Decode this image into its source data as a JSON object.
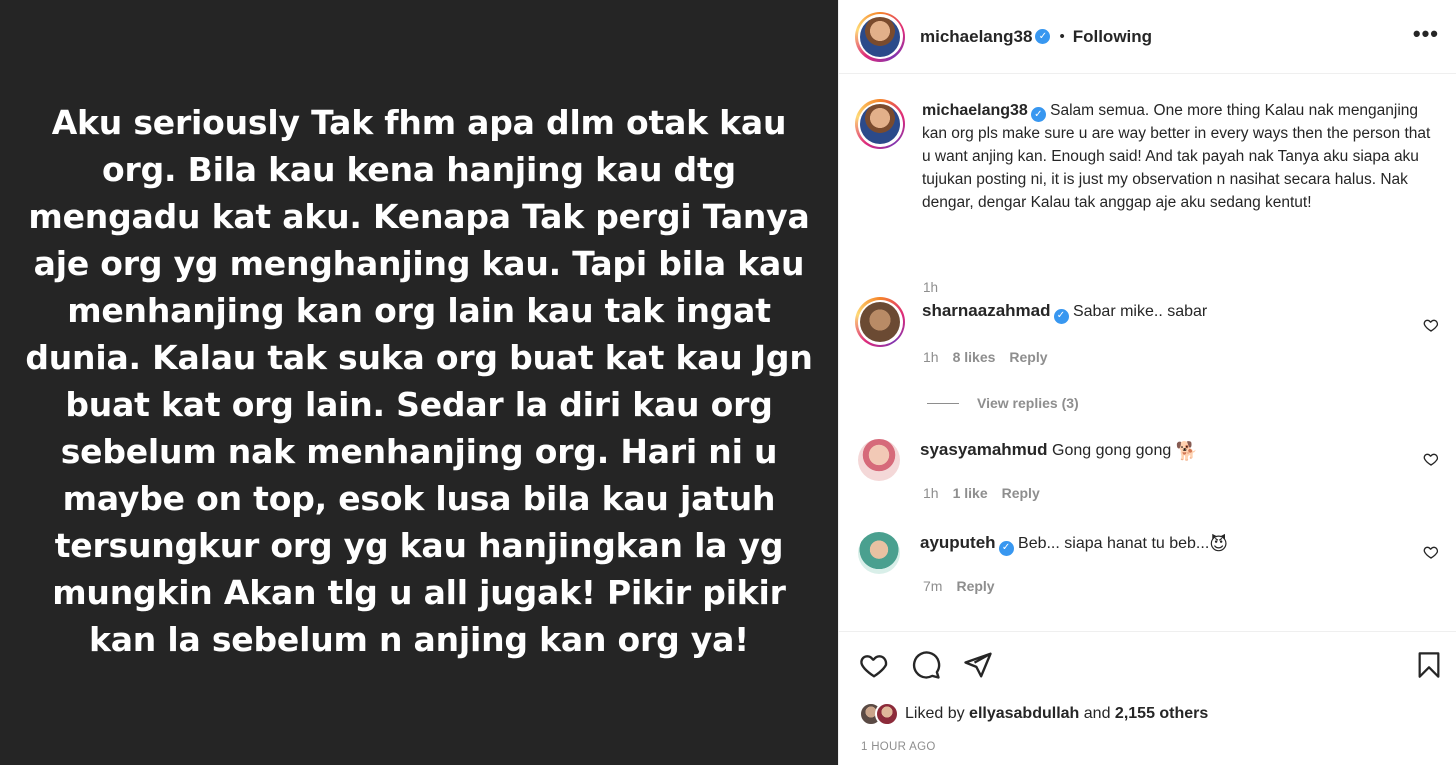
{
  "post": {
    "image_text": "Aku seriously Tak fhm apa dlm otak kau org. Bila kau kena hanjing kau dtg mengadu kat aku. Kenapa Tak pergi Tanya aje org yg menghanjing kau. Tapi bila kau menhanjing kan org lain kau tak ingat dunia. Kalau tak suka org buat kat kau Jgn buat kat org lain. Sedar la diri kau org sebelum nak menhanjing org. Hari ni u maybe on top, esok lusa bila kau jatuh tersungkur org yg kau hanjingkan la yg mungkin Akan tlg u all jugak! Pikir pikir kan la sebelum n anjing kan org ya!",
    "background_color": "#252525"
  },
  "header": {
    "username": "michaelang38",
    "verified_icon": "verified-badge-icon",
    "separator": "•",
    "follow_state": "Following",
    "more_label": "•••"
  },
  "caption": {
    "username": "michaelang38",
    "text": "Salam semua. One more thing Kalau nak menganjing kan org pls make sure u are way better in every ways then the person that u want anjing kan. Enough said! And tak payah nak Tanya aku siapa aku tujukan posting ni, it is just my observation n nasihat secara halus. Nak dengar, dengar Kalau tak anggap aje aku sedang kentut!",
    "time": "1h"
  },
  "comments": [
    {
      "username": "sharnaazahmad",
      "verified": true,
      "text": "Sabar mike.. sabar",
      "emoji": "",
      "time": "1h",
      "likes": "8 likes",
      "reply_label": "Reply"
    },
    {
      "username": "syasyamahmud",
      "verified": false,
      "text": "Gong gong gong ",
      "emoji": "🐕",
      "time": "1h",
      "likes": "1 like",
      "reply_label": "Reply"
    },
    {
      "username": "ayuputeh",
      "verified": true,
      "text": "Beb... siapa hanat tu beb...",
      "emoji": "😈",
      "time": "7m",
      "likes": "",
      "reply_label": "Reply"
    }
  ],
  "view_replies": "View replies (3)",
  "actions": {
    "icons": [
      "heart-icon",
      "comment-icon",
      "share-icon",
      "bookmark-icon"
    ]
  },
  "likes": {
    "prefix": "Liked by",
    "user": "ellyasabdullah",
    "joiner": "and",
    "others": "2,155 others"
  },
  "timestamp": "1 HOUR AGO",
  "colors": {
    "verified": "#3897f0",
    "muted": "#8e8e8e",
    "text": "#262626"
  }
}
